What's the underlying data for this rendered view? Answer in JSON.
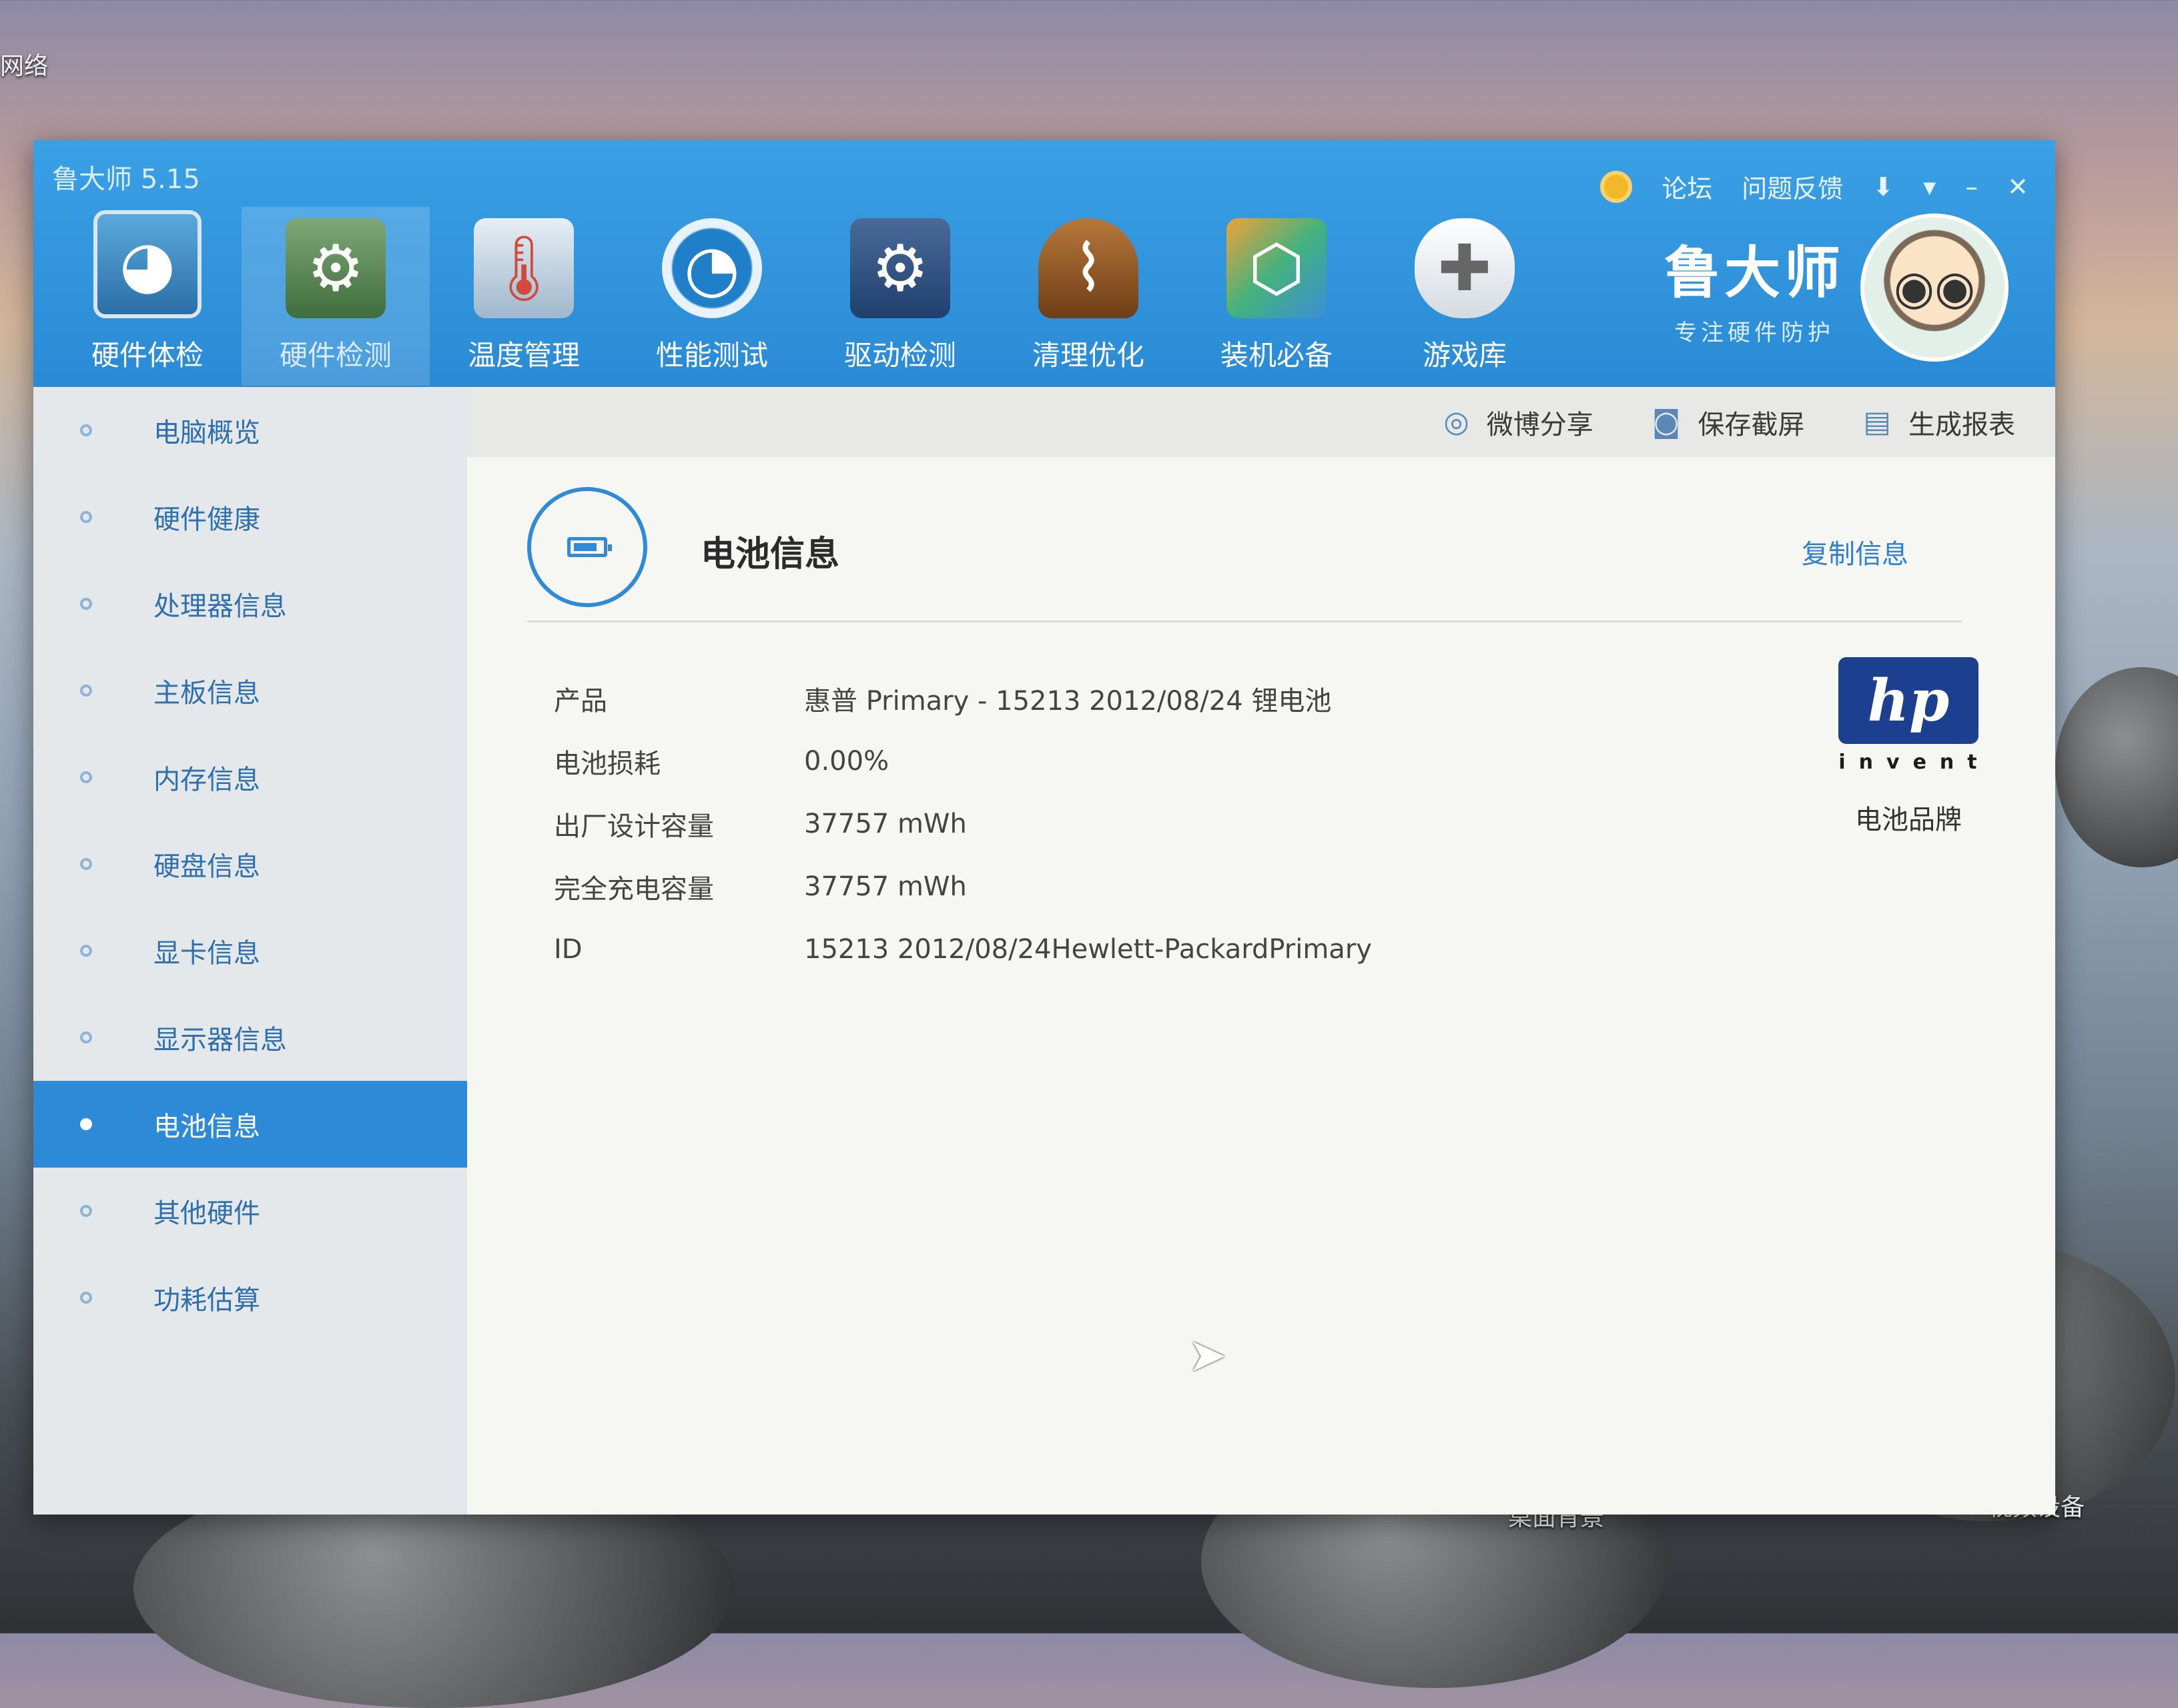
{
  "desktop": {
    "icon_labels": [
      "网络",
      "桌面背景",
      "视频设备"
    ]
  },
  "window": {
    "app_title": "鲁大师 5.15",
    "top_links": {
      "forum": "论坛",
      "feedback": "问题反馈"
    },
    "nav_tabs": [
      {
        "label": "硬件体检",
        "icon": "monitor-icon"
      },
      {
        "label": "硬件检测",
        "icon": "graphics-card-icon",
        "active": true
      },
      {
        "label": "温度管理",
        "icon": "thermometer-icon"
      },
      {
        "label": "性能测试",
        "icon": "speedometer-icon"
      },
      {
        "label": "驱动检测",
        "icon": "driver-gear-icon"
      },
      {
        "label": "清理优化",
        "icon": "broom-icon"
      },
      {
        "label": "装机必备",
        "icon": "cube-icon"
      },
      {
        "label": "游戏库",
        "icon": "gamepad-icon"
      }
    ],
    "brand": {
      "name": "鲁大师",
      "slogan": "专注硬件防护"
    }
  },
  "sidebar": {
    "items": [
      {
        "label": "电脑概览"
      },
      {
        "label": "硬件健康"
      },
      {
        "label": "处理器信息"
      },
      {
        "label": "主板信息"
      },
      {
        "label": "内存信息"
      },
      {
        "label": "硬盘信息"
      },
      {
        "label": "显卡信息"
      },
      {
        "label": "显示器信息"
      },
      {
        "label": "电池信息",
        "active": true
      },
      {
        "label": "其他硬件"
      },
      {
        "label": "功耗估算"
      }
    ]
  },
  "toolbar": {
    "weibo_share": "微博分享",
    "save_screenshot": "保存截屏",
    "generate_report": "生成报表"
  },
  "battery": {
    "title": "电池信息",
    "copy_label": "复制信息",
    "rows": [
      {
        "key": "产品",
        "value": "惠普 Primary - 15213 2012/08/24 锂电池"
      },
      {
        "key": "电池损耗",
        "value": "0.00%"
      },
      {
        "key": "出厂设计容量",
        "value": "37757 mWh"
      },
      {
        "key": "完全充电容量",
        "value": "37757 mWh"
      },
      {
        "key": "ID",
        "value": "15213 2012/08/24Hewlett-PackardPrimary"
      }
    ],
    "brand_logo_text": "hp",
    "brand_logo_subtext": "invent",
    "brand_caption": "电池品牌"
  },
  "colors": {
    "titlebar": "#2a8ad6",
    "sidebar_active": "#2d8ad6",
    "link": "#2f7fcf"
  }
}
